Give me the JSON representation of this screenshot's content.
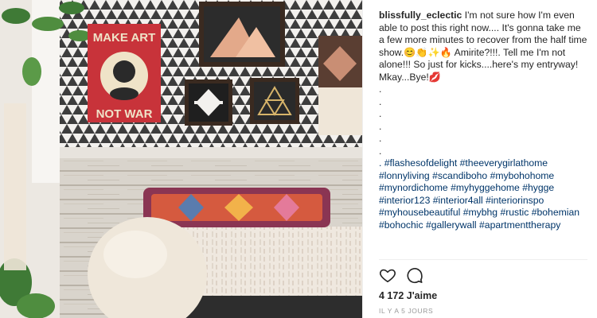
{
  "post": {
    "username": "blissfully_eclectic",
    "caption_lines": [
      " I'm not sure how I'm even able to post this right now.... It's gonna take me a few more minutes to recover from the half time show.😊👏✨🔥 Amirite?!!!. Tell me I'm not alone!!! So just for kicks....here's my entryway! Mkay...Bye!💋",
      ".",
      ".",
      ".",
      ".",
      ".",
      "."
    ],
    "hashtags": ". #flashesofdelight #theeverygirlathome #lonnyliving #scandiboho #mybohohome #mynordichome #myhyggehome #hygge #interior123 #interior4all #interiorinspo #myhousebeautiful #mybhg #rustic #bohemian #bohochic #gallerywall #apartmenttherapy",
    "likes": "4 172 J'aime",
    "time_ago": "IL Y A 5 JOURS"
  },
  "photo": {
    "poster_top": "MAKE ART",
    "poster_bottom": "NOT WAR"
  },
  "colors": {
    "text": "#262626",
    "hashtag": "#003569",
    "muted": "#999999",
    "poster_red": "#c8333a"
  },
  "icons": [
    "heart-icon",
    "comment-icon"
  ]
}
